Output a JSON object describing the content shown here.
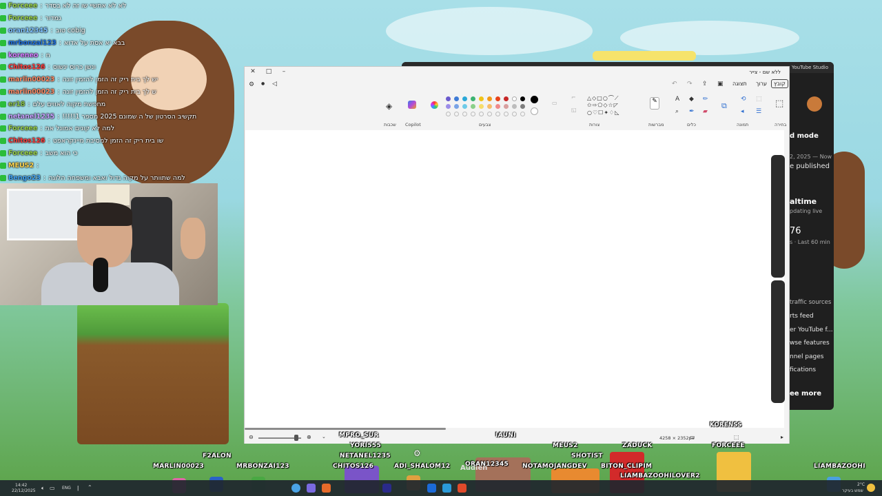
{
  "colors": {
    "accent": "#2f6fd0",
    "chat_green": "#2bbd3a",
    "canvas": "#ffffff",
    "paint_chrome": "#f3f3f3"
  },
  "chat": [
    {
      "user": "Forceee",
      "color": "#9ad24b",
      "msg": "לא לא אחשיי שו זה לא בסדר"
    },
    {
      "user": "Forceee",
      "color": "#9ad24b",
      "msg": "גמדור"
    },
    {
      "user": "oran12345",
      "color": "#7ec0ff",
      "msg": "cobig טוב"
    },
    {
      "user": "mrbonzai123",
      "color": "#1e6fe0",
      "msg": "בבא יא אסת על אדוא"
    },
    {
      "user": "koreneo",
      "color": "#d47cff",
      "msg": "ח"
    },
    {
      "user": "Chitos126",
      "color": "#ff3b3b",
      "msg": "ונשן כרוס ינשוס"
    },
    {
      "user": "marlin00023",
      "color": "#ff8a65",
      "msg": "יש לך בית ריק זה הזמן להזמין זונה"
    },
    {
      "user": "marlin00023",
      "color": "#ff8a65",
      "msg": "ש לך בית ריק זה הזמן להזמין זונה"
    },
    {
      "user": "er18",
      "color": "#8bc34a",
      "msg": "מחפשת מקוה לאווים עלם"
    },
    {
      "user": "netanel1235",
      "color": "#c7a1ff",
      "msg": "תקשיב הסרטון של ה שמונם 2025 מספר 1!!!!!"
    },
    {
      "user": "Forceee",
      "color": "#9ad24b",
      "msg": "למה לא קונים אמונל את"
    },
    {
      "user": "Chitos126",
      "color": "#ff3b3b",
      "msg": "שו בית ריק זה הזמן למסיבת מיינקראפט"
    },
    {
      "user": "Forceee",
      "color": "#9ad24b",
      "msg": "כי הוא משב"
    },
    {
      "user": "MEUS2",
      "color": "#ffd54f",
      "msg": ""
    },
    {
      "user": "Bengo23",
      "color": "#42a5f5",
      "msg": "למה שתוותר על מקוה גדול ואבא ומשפחה הלוגה"
    }
  ],
  "youtube": {
    "window_title": "YouTube Studio",
    "items": [
      "d mode",
      "2, 2025 — Now",
      "e published",
      "altime",
      "pdating live",
      "76",
      "s · Last 60 min",
      "traffic sources",
      "rts feed",
      "er YouTube f...",
      "wse features",
      "nnel pages",
      "fications",
      "ee more"
    ]
  },
  "paint": {
    "title": "ללא שם - צייר",
    "menu": {
      "file": "קובץ",
      "edit": "ערוך",
      "view": "תצוגה"
    },
    "groups": {
      "layers": "שכבות",
      "copilot": "Copilot",
      "colors": "צבעים",
      "shapes": "צורות",
      "brushes": "מברשות",
      "tools": "כלים",
      "image": "תמונה",
      "selection": "בחירה"
    },
    "status": {
      "dimensions": "4258 × 2352px"
    },
    "palette_row1": [
      "#6a5acd",
      "#3e7bd6",
      "#2aa8d8",
      "#3cb371",
      "#f0c419",
      "#f29b1a",
      "#e8431a",
      "#c62828",
      "#ffffff",
      "#000000"
    ],
    "palette_row2": [
      "#9c8de8",
      "#7aa4e6",
      "#6fcbe8",
      "#8ad08a",
      "#f7dd6a",
      "#f7bd6a",
      "#f08a8a",
      "#d8a0a0",
      "#bdbdbd",
      "#7d7d7d"
    ]
  },
  "nametags": {
    "korenss": "KORENSS",
    "mpro_sur": "MPRO_SUR",
    "iauni": "IAUNI",
    "meus2": "MEUS2",
    "zaduck": "ZADUCK",
    "forceee": "FORCEEE",
    "yori555": "YORI555",
    "shotist": "SHOTIST",
    "f2alon": "F2ALON",
    "netanel1235": "NETANEL1235",
    "marlin00023": "MARLIN00023",
    "mrbonzai123": "MRBONZAI123",
    "chitos126": "CHITOS126",
    "adi_shalom12": "ADI_SHALOM12",
    "oran12345": "ORAN12345",
    "notamojangdev": "NOTAMOJANGDEV",
    "biton_clipim": "BITON_CLIPIM",
    "liambazoohiloverz": "LIAMBAZOOHILOVER2",
    "liambazoohi": "LIAMBAZOOHI",
    "audience": "Audien"
  },
  "taskbar": {
    "time": "14:42",
    "date": "22/12/2025",
    "lang": "ENG",
    "weather": "2°C",
    "weather_text": "שמש בעיקר"
  }
}
